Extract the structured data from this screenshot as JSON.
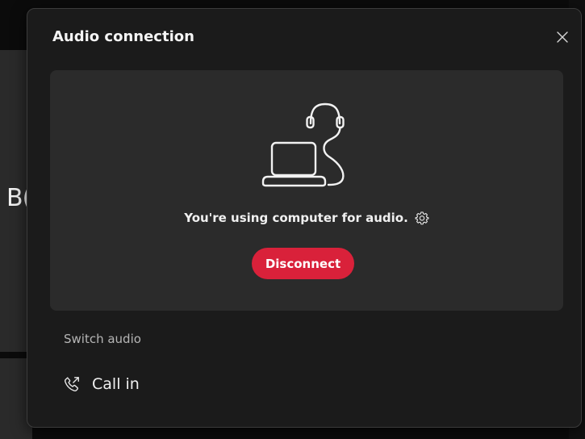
{
  "background": {
    "partial_text": "B("
  },
  "dialog": {
    "title": "Audio connection",
    "close_icon": "close-icon",
    "card": {
      "illustration_icon": "laptop-headset-icon",
      "status_text": "You're using computer for audio.",
      "settings_icon": "gear-icon",
      "disconnect_label": "Disconnect"
    },
    "switch_audio": {
      "label": "Switch audio",
      "options": [
        {
          "label": "Call in",
          "icon": "phone-outgoing-icon"
        }
      ]
    }
  },
  "colors": {
    "dialog_bg": "#1b1b1b",
    "card_bg": "#2b2b2b",
    "accent_danger": "#d9213a",
    "text_primary": "#f0f0f0",
    "text_secondary": "#b5b5b5"
  }
}
